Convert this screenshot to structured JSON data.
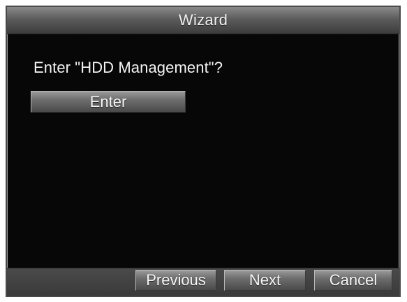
{
  "dialog": {
    "title": "Wizard",
    "question": "Enter \"HDD Management\"?",
    "enter_label": "Enter"
  },
  "footer": {
    "previous_label": "Previous",
    "next_label": "Next",
    "cancel_label": "Cancel"
  },
  "colors": {
    "background": "#070707",
    "titlebar": "#5c5c5c",
    "button": "#6e6e6e",
    "text": "#f4f4f4"
  }
}
